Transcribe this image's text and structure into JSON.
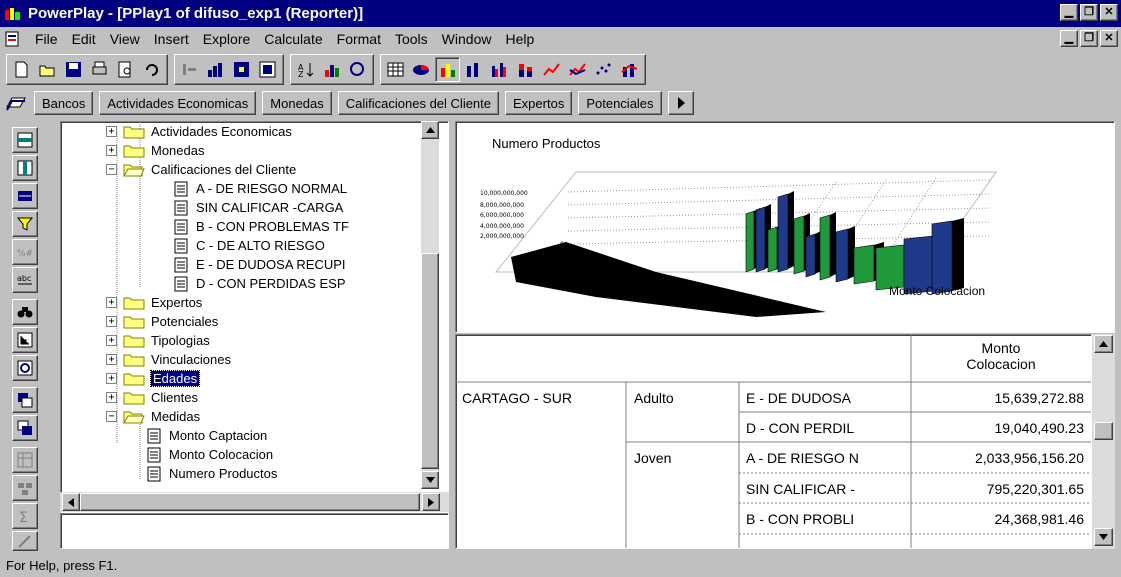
{
  "window": {
    "title": "PowerPlay - [PPlay1 of difuso_exp1 (Reporter)]",
    "controls": [
      "_",
      "▭",
      "×"
    ]
  },
  "menu": {
    "items": [
      "File",
      "Edit",
      "View",
      "Insert",
      "Explore",
      "Calculate",
      "Format",
      "Tools",
      "Window",
      "Help"
    ]
  },
  "dimension_bar": {
    "tabs": [
      "Bancos",
      "Actividades Economicas",
      "Monedas",
      "Calificaciones del Cliente",
      "Expertos",
      "Potenciales"
    ]
  },
  "tree": {
    "rows": [
      {
        "label": "Actividades Economicas",
        "type": "folder",
        "expander": "+"
      },
      {
        "label": "Monedas",
        "type": "folder",
        "expander": "+"
      },
      {
        "label": "Calificaciones del Cliente",
        "type": "folder-open",
        "expander": "−"
      },
      {
        "label": "A - DE RIESGO NORMAL",
        "type": "leaf"
      },
      {
        "label": "SIN CALIFICAR -CARGA",
        "type": "leaf"
      },
      {
        "label": "B - CON PROBLEMAS TF",
        "type": "leaf"
      },
      {
        "label": "C - DE ALTO RIESGO",
        "type": "leaf"
      },
      {
        "label": "E - DE DUDOSA RECUPI",
        "type": "leaf"
      },
      {
        "label": "D - CON PERDIDAS ESP",
        "type": "leaf"
      },
      {
        "label": "Expertos",
        "type": "folder",
        "expander": "+"
      },
      {
        "label": "Potenciales",
        "type": "folder",
        "expander": "+"
      },
      {
        "label": "Tipologias",
        "type": "folder",
        "expander": "+"
      },
      {
        "label": "Vinculaciones",
        "type": "folder",
        "expander": "+"
      },
      {
        "label": "Edades",
        "type": "folder",
        "expander": "+",
        "selected": true
      },
      {
        "label": "Clientes",
        "type": "folder",
        "expander": "+"
      },
      {
        "label": "Medidas",
        "type": "folder-open",
        "expander": "−"
      },
      {
        "label": "Monto Captacion",
        "type": "leaf"
      },
      {
        "label": "Monto Colocacion",
        "type": "leaf"
      },
      {
        "label": "Numero Productos",
        "type": "leaf"
      }
    ]
  },
  "chart": {
    "title": "Numero Productos",
    "axis_label": "Monto Colocacion",
    "tick_labels": [
      "10,000,000,000",
      "8,000,000,000",
      "6,000,000,000",
      "4,000,000,000",
      "2,000,000,000",
      "0"
    ]
  },
  "chart_data": {
    "type": "bar",
    "title": "Numero Productos",
    "xlabel": "",
    "ylabel": "Monto Colocacion",
    "ylim": [
      0,
      10000000000
    ],
    "grid": true
  },
  "grid": {
    "measure_header": "Monto\nColocacion",
    "rows": [
      {
        "region": "CARTAGO - SUR",
        "age": "Adulto",
        "category": "E - DE DUDOSA",
        "value": "15,639,272.88"
      },
      {
        "region": "",
        "age": "",
        "category": "D - CON PERDIL",
        "value": "19,040,490.23"
      },
      {
        "region": "",
        "age": "Joven",
        "category": "A - DE RIESGO N",
        "value": "2,033,956,156.20"
      },
      {
        "region": "",
        "age": "",
        "category": "SIN CALIFICAR -",
        "value": "795,220,301.65"
      },
      {
        "region": "",
        "age": "",
        "category": "B - CON PROBLI",
        "value": "24,368,981.46"
      }
    ]
  },
  "status": {
    "text": "For Help, press F1."
  },
  "colors": {
    "titlebar": "#000080",
    "face": "#c0c0c0",
    "bar_blue": "#1f3a8a",
    "bar_green": "#1f9a3a"
  }
}
